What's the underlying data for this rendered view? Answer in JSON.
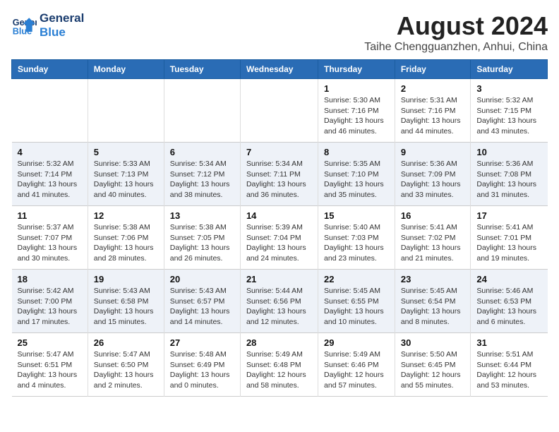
{
  "logo": {
    "line1": "General",
    "line2": "Blue"
  },
  "header": {
    "month_year": "August 2024",
    "location": "Taihe Chengguanzhen, Anhui, China"
  },
  "days_of_week": [
    "Sunday",
    "Monday",
    "Tuesday",
    "Wednesday",
    "Thursday",
    "Friday",
    "Saturday"
  ],
  "weeks": [
    [
      {
        "day": "",
        "info": ""
      },
      {
        "day": "",
        "info": ""
      },
      {
        "day": "",
        "info": ""
      },
      {
        "day": "",
        "info": ""
      },
      {
        "day": "1",
        "info": "Sunrise: 5:30 AM\nSunset: 7:16 PM\nDaylight: 13 hours\nand 46 minutes."
      },
      {
        "day": "2",
        "info": "Sunrise: 5:31 AM\nSunset: 7:16 PM\nDaylight: 13 hours\nand 44 minutes."
      },
      {
        "day": "3",
        "info": "Sunrise: 5:32 AM\nSunset: 7:15 PM\nDaylight: 13 hours\nand 43 minutes."
      }
    ],
    [
      {
        "day": "4",
        "info": "Sunrise: 5:32 AM\nSunset: 7:14 PM\nDaylight: 13 hours\nand 41 minutes."
      },
      {
        "day": "5",
        "info": "Sunrise: 5:33 AM\nSunset: 7:13 PM\nDaylight: 13 hours\nand 40 minutes."
      },
      {
        "day": "6",
        "info": "Sunrise: 5:34 AM\nSunset: 7:12 PM\nDaylight: 13 hours\nand 38 minutes."
      },
      {
        "day": "7",
        "info": "Sunrise: 5:34 AM\nSunset: 7:11 PM\nDaylight: 13 hours\nand 36 minutes."
      },
      {
        "day": "8",
        "info": "Sunrise: 5:35 AM\nSunset: 7:10 PM\nDaylight: 13 hours\nand 35 minutes."
      },
      {
        "day": "9",
        "info": "Sunrise: 5:36 AM\nSunset: 7:09 PM\nDaylight: 13 hours\nand 33 minutes."
      },
      {
        "day": "10",
        "info": "Sunrise: 5:36 AM\nSunset: 7:08 PM\nDaylight: 13 hours\nand 31 minutes."
      }
    ],
    [
      {
        "day": "11",
        "info": "Sunrise: 5:37 AM\nSunset: 7:07 PM\nDaylight: 13 hours\nand 30 minutes."
      },
      {
        "day": "12",
        "info": "Sunrise: 5:38 AM\nSunset: 7:06 PM\nDaylight: 13 hours\nand 28 minutes."
      },
      {
        "day": "13",
        "info": "Sunrise: 5:38 AM\nSunset: 7:05 PM\nDaylight: 13 hours\nand 26 minutes."
      },
      {
        "day": "14",
        "info": "Sunrise: 5:39 AM\nSunset: 7:04 PM\nDaylight: 13 hours\nand 24 minutes."
      },
      {
        "day": "15",
        "info": "Sunrise: 5:40 AM\nSunset: 7:03 PM\nDaylight: 13 hours\nand 23 minutes."
      },
      {
        "day": "16",
        "info": "Sunrise: 5:41 AM\nSunset: 7:02 PM\nDaylight: 13 hours\nand 21 minutes."
      },
      {
        "day": "17",
        "info": "Sunrise: 5:41 AM\nSunset: 7:01 PM\nDaylight: 13 hours\nand 19 minutes."
      }
    ],
    [
      {
        "day": "18",
        "info": "Sunrise: 5:42 AM\nSunset: 7:00 PM\nDaylight: 13 hours\nand 17 minutes."
      },
      {
        "day": "19",
        "info": "Sunrise: 5:43 AM\nSunset: 6:58 PM\nDaylight: 13 hours\nand 15 minutes."
      },
      {
        "day": "20",
        "info": "Sunrise: 5:43 AM\nSunset: 6:57 PM\nDaylight: 13 hours\nand 14 minutes."
      },
      {
        "day": "21",
        "info": "Sunrise: 5:44 AM\nSunset: 6:56 PM\nDaylight: 13 hours\nand 12 minutes."
      },
      {
        "day": "22",
        "info": "Sunrise: 5:45 AM\nSunset: 6:55 PM\nDaylight: 13 hours\nand 10 minutes."
      },
      {
        "day": "23",
        "info": "Sunrise: 5:45 AM\nSunset: 6:54 PM\nDaylight: 13 hours\nand 8 minutes."
      },
      {
        "day": "24",
        "info": "Sunrise: 5:46 AM\nSunset: 6:53 PM\nDaylight: 13 hours\nand 6 minutes."
      }
    ],
    [
      {
        "day": "25",
        "info": "Sunrise: 5:47 AM\nSunset: 6:51 PM\nDaylight: 13 hours\nand 4 minutes."
      },
      {
        "day": "26",
        "info": "Sunrise: 5:47 AM\nSunset: 6:50 PM\nDaylight: 13 hours\nand 2 minutes."
      },
      {
        "day": "27",
        "info": "Sunrise: 5:48 AM\nSunset: 6:49 PM\nDaylight: 13 hours\nand 0 minutes."
      },
      {
        "day": "28",
        "info": "Sunrise: 5:49 AM\nSunset: 6:48 PM\nDaylight: 12 hours\nand 58 minutes."
      },
      {
        "day": "29",
        "info": "Sunrise: 5:49 AM\nSunset: 6:46 PM\nDaylight: 12 hours\nand 57 minutes."
      },
      {
        "day": "30",
        "info": "Sunrise: 5:50 AM\nSunset: 6:45 PM\nDaylight: 12 hours\nand 55 minutes."
      },
      {
        "day": "31",
        "info": "Sunrise: 5:51 AM\nSunset: 6:44 PM\nDaylight: 12 hours\nand 53 minutes."
      }
    ]
  ]
}
